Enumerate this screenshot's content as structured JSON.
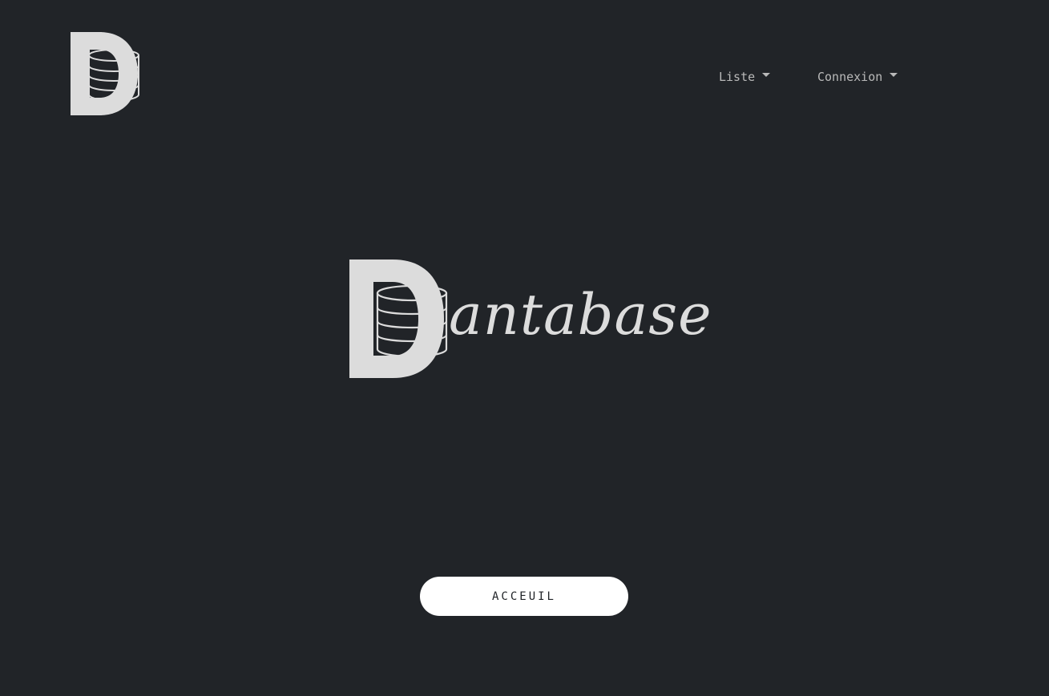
{
  "nav": {
    "logo_icon": "database-d-logo-icon",
    "items": [
      {
        "label": "Liste",
        "icon": "caret-down-icon"
      },
      {
        "label": "Connexion",
        "icon": "caret-down-icon"
      }
    ]
  },
  "hero": {
    "logo_icon": "database-d-logo-icon",
    "wordmark_suffix": "antabase"
  },
  "cta": {
    "label": "ACCEUIL"
  },
  "colors": {
    "background": "#212428",
    "logo": "#dcdcdc",
    "nav_text": "#b9b9b9",
    "button_bg": "#ffffff",
    "button_text": "#212428"
  }
}
